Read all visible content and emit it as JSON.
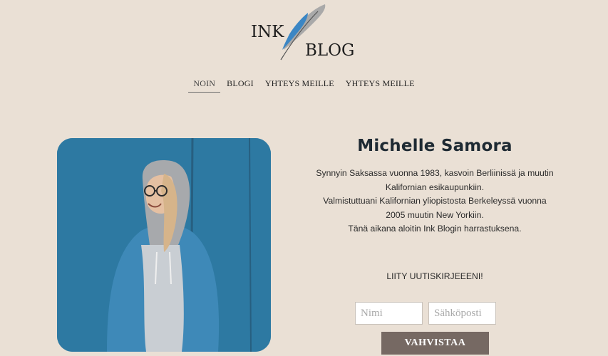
{
  "logo": {
    "line1": "INK",
    "line2": "BLOG"
  },
  "nav": {
    "items": [
      {
        "label": "NOIN"
      },
      {
        "label": "BLOGI"
      },
      {
        "label": "YHTEYS MEILLE"
      },
      {
        "label": "YHTEYS MEILLE"
      }
    ],
    "active_index": 0
  },
  "profile": {
    "name": "Michelle Samora",
    "bio_lines": [
      "Synnyin Saksassa vuonna 1983, kasvoin Berliinissä ja muutin",
      "Kalifornian esikaupunkiin.",
      "Valmistuttuani Kalifornian yliopistosta Berkeleyssä vuonna",
      "2005 muutin New Yorkiin.",
      "Tänä aikana aloitin Ink Blogin harrastuksena."
    ]
  },
  "newsletter": {
    "heading": "LIITY UUTISKIRJEEENI!",
    "name_placeholder": "Nimi",
    "email_placeholder": "Sähköposti",
    "submit_label": "VAHVISTAA"
  },
  "colors": {
    "background": "#eae0d5",
    "button": "#766963",
    "photo_blue": "#2f7fa9",
    "feather_blue": "#3b86c4"
  }
}
